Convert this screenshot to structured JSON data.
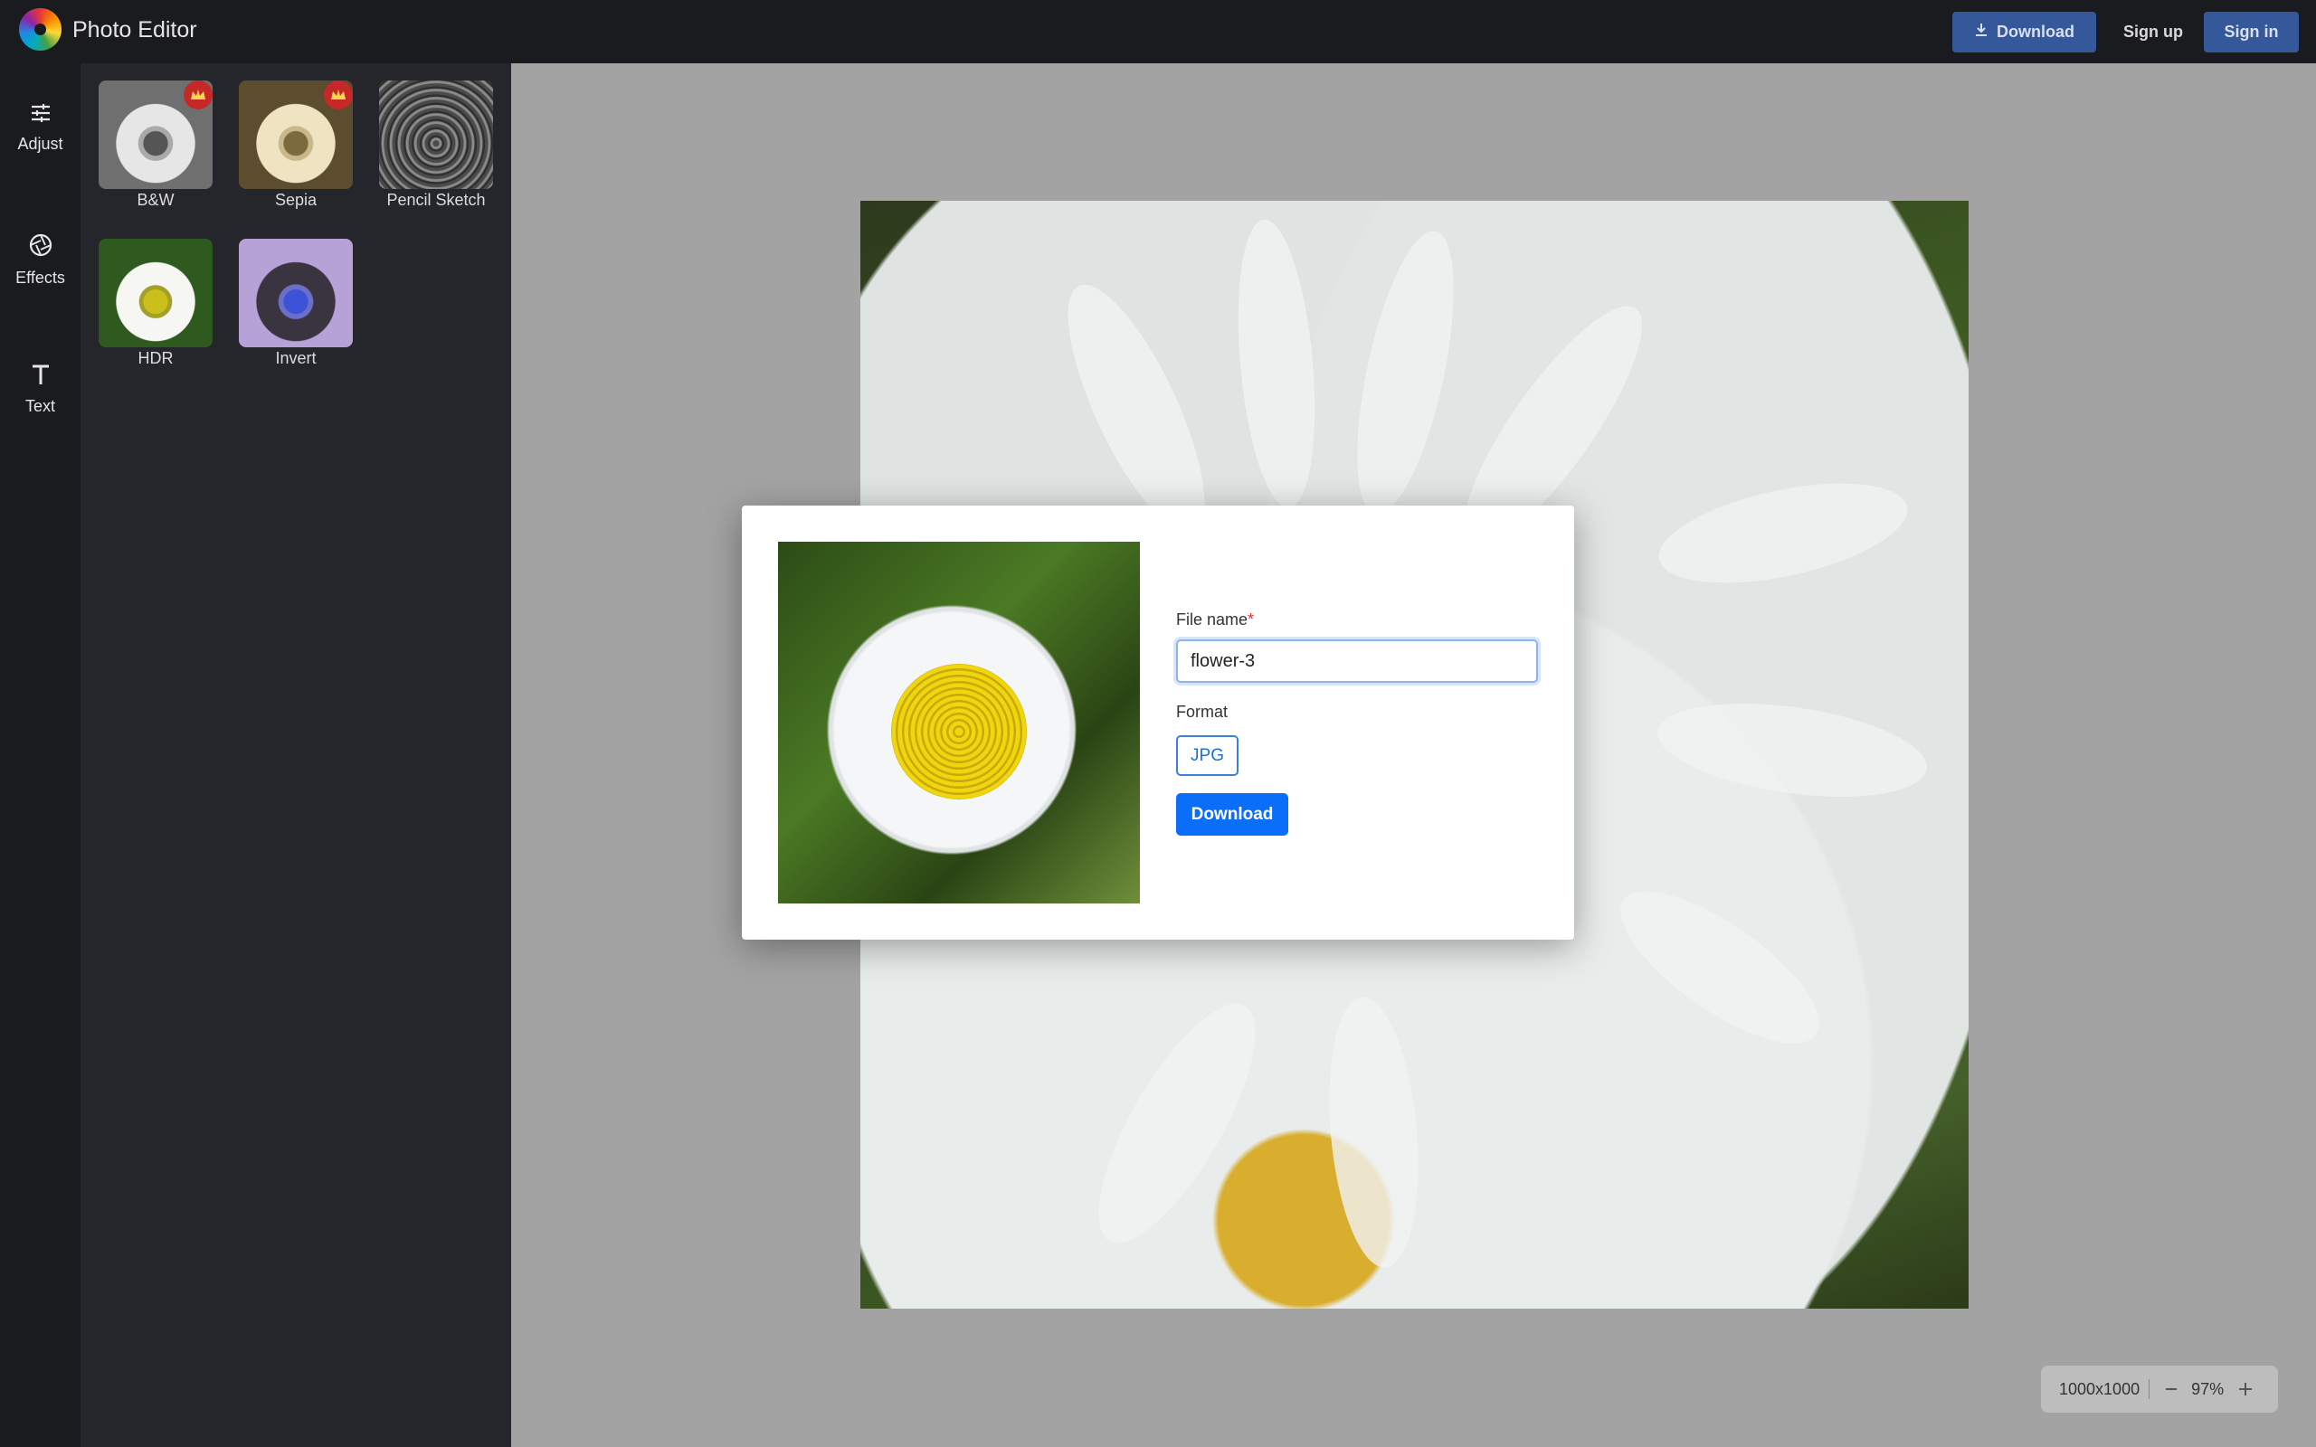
{
  "app": {
    "title": "Photo Editor"
  },
  "topbar": {
    "download_label": "Download",
    "signup_label": "Sign up",
    "signin_label": "Sign in"
  },
  "leftnav": {
    "items": [
      {
        "label": "Adjust",
        "icon": "sliders-icon"
      },
      {
        "label": "Effects",
        "icon": "aperture-icon"
      },
      {
        "label": "Text",
        "icon": "text-icon"
      }
    ]
  },
  "effects": {
    "items": [
      {
        "label": "B&W",
        "premium": true
      },
      {
        "label": "Sepia",
        "premium": true
      },
      {
        "label": "Pencil Sketch",
        "premium": false
      },
      {
        "label": "HDR",
        "premium": false
      },
      {
        "label": "Invert",
        "premium": false
      }
    ]
  },
  "zoom": {
    "dimensions": "1000x1000",
    "value": "97%"
  },
  "modal": {
    "file_name_label": "File name",
    "required_marker": "*",
    "file_name_value": "flower-3",
    "format_label": "Format",
    "format_value": "JPG",
    "download_label": "Download"
  },
  "colors": {
    "accent": "#0b6ef8",
    "topbar_button": "#35589a",
    "premium_badge": "#c62828"
  }
}
